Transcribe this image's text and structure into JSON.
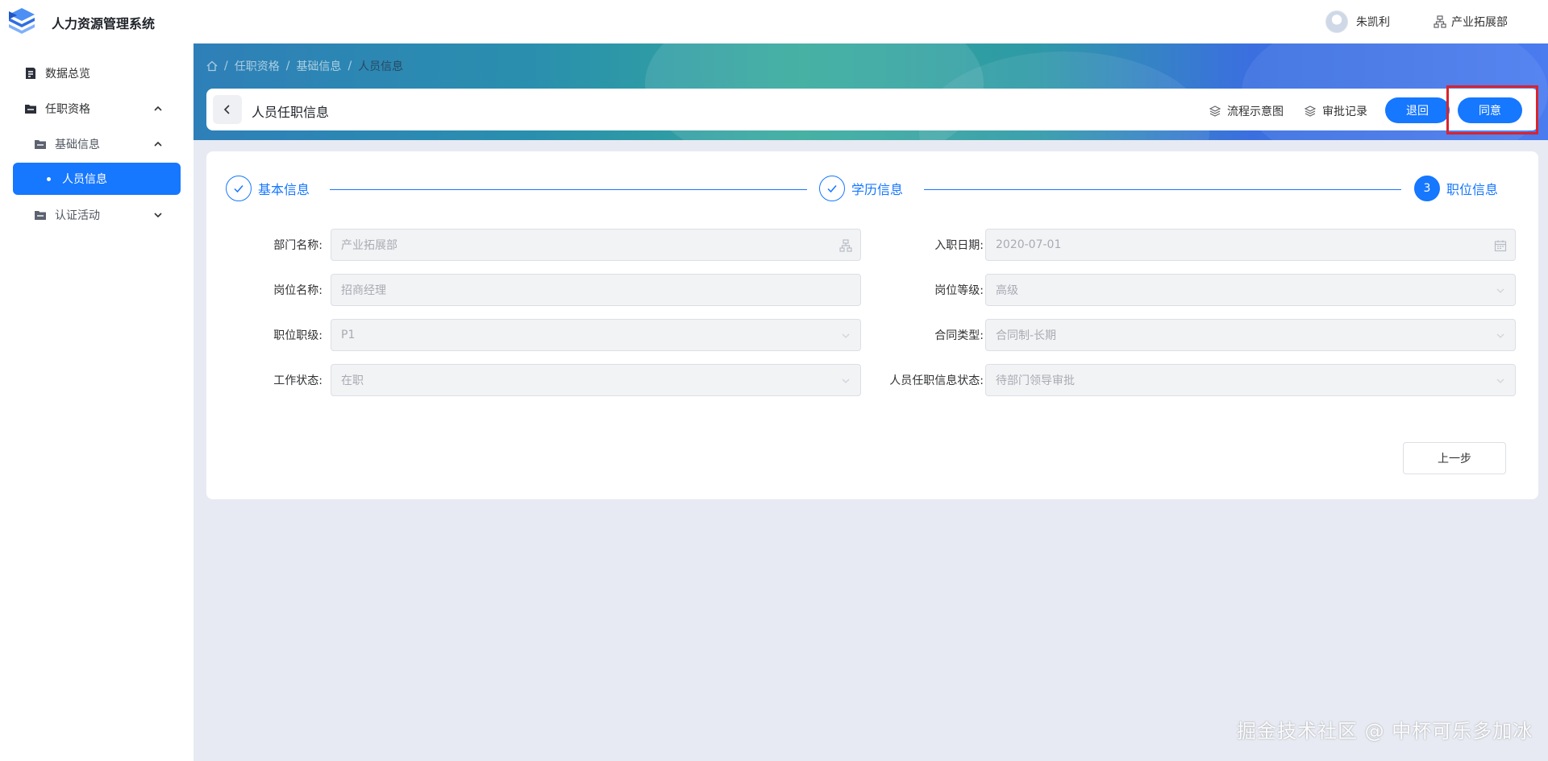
{
  "header": {
    "app_title": "人力资源管理系统",
    "user_name": "朱凯利",
    "department": "产业拓展部"
  },
  "sidebar": {
    "items": [
      {
        "label": "数据总览",
        "icon": "report-icon"
      },
      {
        "label": "任职资格",
        "icon": "folder-icon",
        "expanded": true
      },
      {
        "label": "基础信息",
        "icon": "folder-icon",
        "expanded": true
      },
      {
        "label": "人员信息",
        "active": true
      },
      {
        "label": "认证活动",
        "icon": "folder-icon",
        "expanded": false
      }
    ]
  },
  "breadcrumb": {
    "items": [
      "任职资格",
      "基础信息",
      "人员信息"
    ],
    "separator": "/"
  },
  "page_header": {
    "title": "人员任职信息",
    "flow_link": "流程示意图",
    "audit_link": "审批记录",
    "reject_label": "退回",
    "approve_label": "同意"
  },
  "steps": [
    {
      "label": "基本信息",
      "status": "done"
    },
    {
      "label": "学历信息",
      "status": "done"
    },
    {
      "label": "职位信息",
      "status": "current",
      "number": "3"
    }
  ],
  "form": {
    "dept_label": "部门名称:",
    "dept_value": "产业拓展部",
    "entry_label": "入职日期:",
    "entry_value": "2020-07-01",
    "post_label": "岗位名称:",
    "post_value": "招商经理",
    "grade_label": "岗位等级:",
    "grade_value": "高级",
    "level_label": "职位职级:",
    "level_value": "P1",
    "contract_label": "合同类型:",
    "contract_value": "合同制-长期",
    "work_label": "工作状态:",
    "work_value": "在职",
    "status_label": "人员任职信息状态:",
    "status_value": "待部门领导审批"
  },
  "actions": {
    "prev_label": "上一步"
  },
  "watermark": "掘金技术社区 @ 中杯可乐多加冰",
  "colors": {
    "primary": "#1677ff",
    "highlight_border": "#d9232e"
  }
}
